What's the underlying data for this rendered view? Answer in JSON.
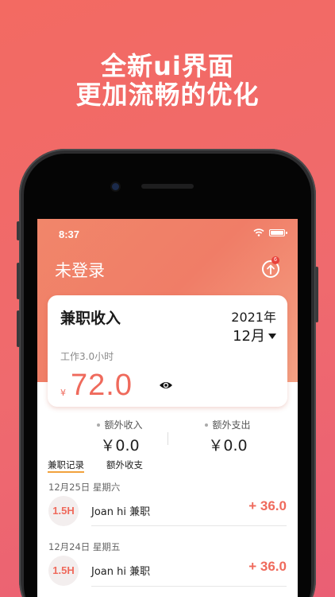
{
  "promo": {
    "line1": "全新ui界面",
    "line2": "更加流畅的优化"
  },
  "status_bar": {
    "time": "8:37"
  },
  "header": {
    "title": "未登录",
    "badge_count": "6"
  },
  "card": {
    "title": "兼职收入",
    "year": "2021年",
    "month": "12月",
    "hours": "工作3.0小时",
    "currency": "¥",
    "amount": "72.0"
  },
  "extras": {
    "income_label": "额外收入",
    "income_value": "￥0.0",
    "expense_label": "额外支出",
    "expense_value": "￥0.0"
  },
  "tabs": [
    {
      "label": "兼职记录",
      "active": true
    },
    {
      "label": "额外收支",
      "active": false
    }
  ],
  "records": [
    {
      "date": "12月25日  星期六",
      "hours": "1.5H",
      "name": "Joan hi 兼职",
      "amount": "+ 36.0"
    },
    {
      "date": "12月24日  星期五",
      "hours": "1.5H",
      "name": "Joan hi 兼职",
      "amount": "+ 36.0"
    }
  ],
  "colors": {
    "accent": "#ef6a5c",
    "tab_underline": "#f1a23d",
    "background": "#ef6a6e"
  }
}
